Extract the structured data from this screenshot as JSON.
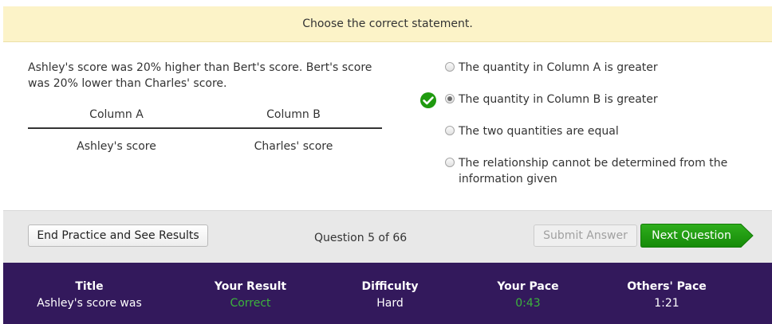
{
  "prompt": "Choose the correct statement.",
  "question": {
    "text": "Ashley's score was 20% higher than Bert's score. Bert's score was 20% lower than Charles' score.",
    "column_a_header": "Column A",
    "column_b_header": "Column B",
    "column_a_value": "Ashley's score",
    "column_b_value": "Charles' score"
  },
  "options": [
    {
      "label": "The quantity in Column A is greater",
      "selected": false,
      "correct": false
    },
    {
      "label": "The quantity in Column B is greater",
      "selected": true,
      "correct": true
    },
    {
      "label": "The two quantities are equal",
      "selected": false,
      "correct": false
    },
    {
      "label": "The relationship cannot be determined from the information given",
      "selected": false,
      "correct": false
    }
  ],
  "actions": {
    "end_label": "End Practice and See Results",
    "counter": "Question 5 of 66",
    "submit_label": "Submit Answer",
    "next_label": "Next Question"
  },
  "stats": {
    "title_head": "Title",
    "title_val": "Ashley's score was",
    "result_head": "Your Result",
    "result_val": "Correct",
    "difficulty_head": "Difficulty",
    "difficulty_val": "Hard",
    "pace_head": "Your Pace",
    "pace_val": "0:43",
    "others_head": "Others' Pace",
    "others_val": "1:21"
  },
  "colors": {
    "prompt_bg": "#fcf3c8",
    "accent_green": "#1f9a0f",
    "result_green": "#3cb43c",
    "stats_bg": "#33195c"
  },
  "icons": {
    "correct_marker": "check-circle-icon"
  }
}
